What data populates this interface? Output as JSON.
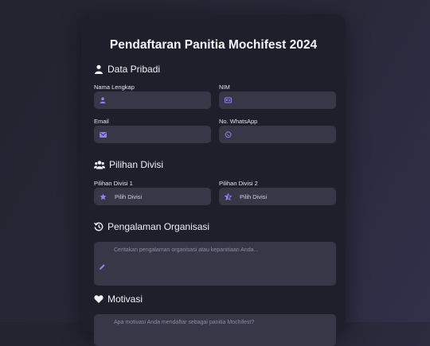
{
  "form": {
    "title": "Pendaftaran Panitia Mochifest 2024",
    "sections": {
      "personal": "Data Pribadi",
      "division": "Pilihan Divisi",
      "experience": "Pengalaman Organisasi",
      "motivation": "Motivasi"
    },
    "fields": {
      "name_label": "Nama Lengkap",
      "nim_label": "NIM",
      "email_label": "Email",
      "whatsapp_label": "No. WhatsApp",
      "division1_label": "Pilihan Divisi 1",
      "division1_value": "Pilih Divisi",
      "division2_label": "Pilihan Divisi 2",
      "division2_value": "Pilih Divisi",
      "experience_placeholder": "Ceritakan pengalaman organisasi atau kepanitiaan Anda...",
      "motivation_placeholder": "Apa motivasi Anda mendaftar sebagai panitia Mochifest?"
    }
  },
  "colors": {
    "accent": "#8b83f0",
    "card": "#1f1f2b",
    "field": "#373748"
  },
  "icons": [
    "user-icon",
    "id-card-icon",
    "envelope-icon",
    "whatsapp-icon",
    "users-icon",
    "star-icon",
    "star-half-icon",
    "history-icon",
    "pencil-icon",
    "heart-icon"
  ]
}
